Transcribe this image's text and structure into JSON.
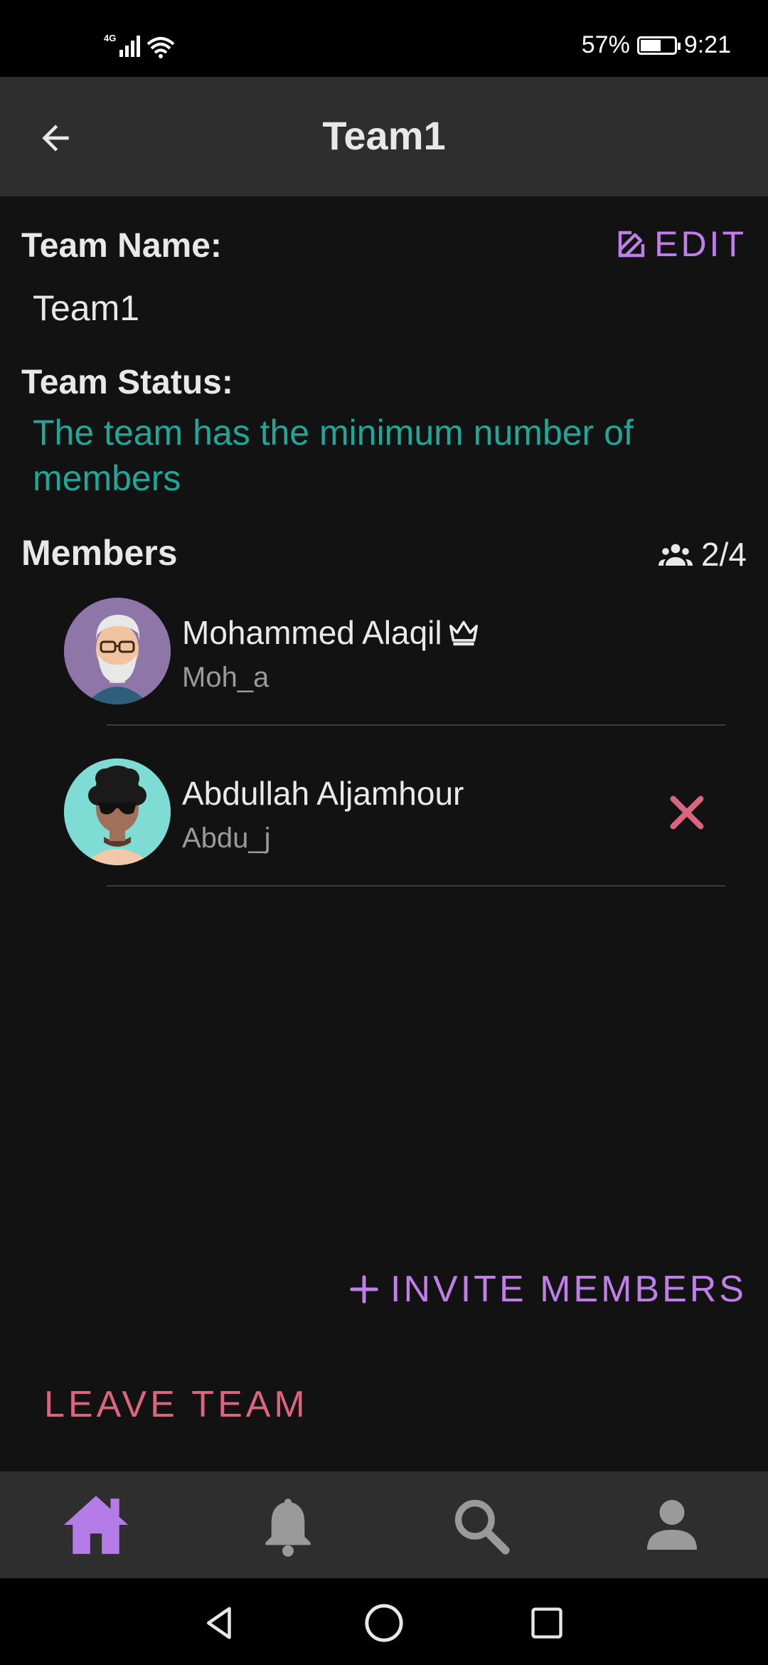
{
  "status_bar": {
    "network": "4G",
    "battery": "57%",
    "time": "9:21"
  },
  "header": {
    "title": "Team1",
    "back_icon": "arrow-back-icon"
  },
  "team": {
    "name_label": "Team Name:",
    "name_value": "Team1",
    "edit_label": "EDIT",
    "status_label": "Team Status:",
    "status_text": "The team has the minimum number of members",
    "status_color": "#1fa89a"
  },
  "members": {
    "label": "Members",
    "count": "2/4",
    "items": [
      {
        "name": "Mohammed Alaqil",
        "username": "Moh_a",
        "is_owner": true
      },
      {
        "name": "Abdullah Aljamhour",
        "username": "Abdu_j",
        "is_owner": false
      }
    ]
  },
  "actions": {
    "invite_label": "INVITE MEMBERS",
    "leave_label": "LEAVE TEAM"
  },
  "bottom_nav": {
    "items": [
      "home-icon",
      "bell-icon",
      "search-icon",
      "person-icon"
    ],
    "active": "home-icon",
    "active_color": "#b57be6"
  },
  "colors": {
    "accent": "#c07ee8",
    "danger": "#d9667e",
    "background": "#121212",
    "bar": "#2e2e2e"
  }
}
